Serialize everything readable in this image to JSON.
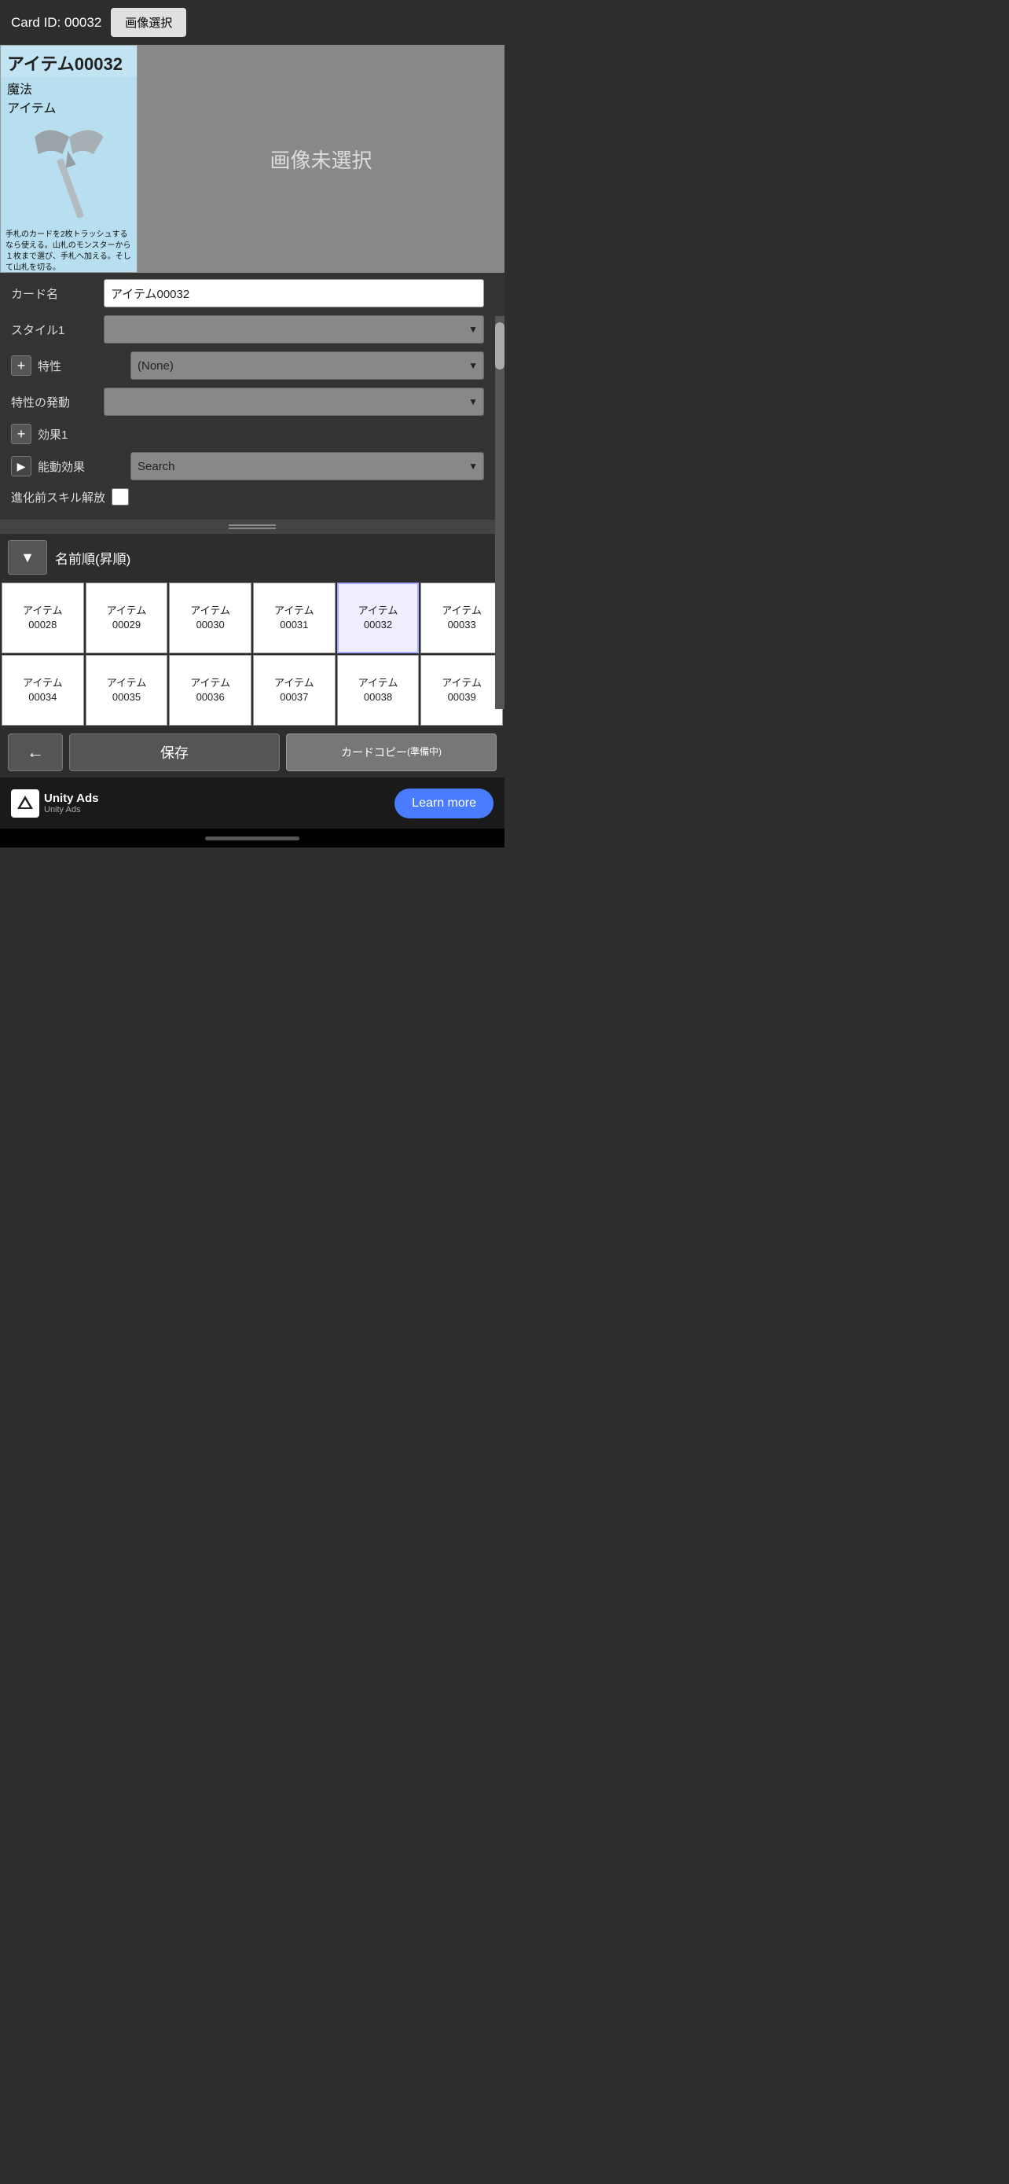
{
  "header": {
    "card_id_label": "Card ID: 00032",
    "image_select_button": "画像選択"
  },
  "card_preview": {
    "title": "アイテム00032",
    "type_line1": "魔法",
    "type_line2": "アイテム",
    "description": "手札のカードを2枚トラッシュするなら使える。山札のモンスターから１枚まで選び、手札へ加える。そして山札を切る。",
    "no_image_text": "画像未選択"
  },
  "form": {
    "card_name_label": "カード名",
    "card_name_value": "アイテム00032",
    "style1_label": "スタイル1",
    "style1_value": "",
    "trait_label": "特性",
    "trait_value": "(None)",
    "trait_trigger_label": "特性の発動",
    "trait_trigger_value": "",
    "effect1_label": "効果1",
    "active_effect_label": "能動効果",
    "active_effect_placeholder": "Search",
    "evolve_skill_label": "進化前スキル解放"
  },
  "sort_bar": {
    "dropdown_arrow": "▼",
    "sort_label": "名前順(昇順)"
  },
  "grid": {
    "rows": [
      [
        "アイテム\n00028",
        "アイテム\n00029",
        "アイテム\n00030",
        "アイテム\n00031",
        "アイテム\n00032",
        "アイテム\n00033"
      ],
      [
        "アイテム\n00034",
        "アイテム\n00035",
        "アイテム\n00036",
        "アイテム\n00037",
        "アイテム\n00038",
        "アイテム\n00039"
      ]
    ]
  },
  "bottom_bar": {
    "back_arrow": "←",
    "save_label": "保存",
    "copy_label": "カードコピー\n(準備中)"
  },
  "ads": {
    "unity_ads_text": "Unity Ads",
    "unity_ads_small": "Unity  Ads",
    "learn_more_label": "Learn more"
  }
}
